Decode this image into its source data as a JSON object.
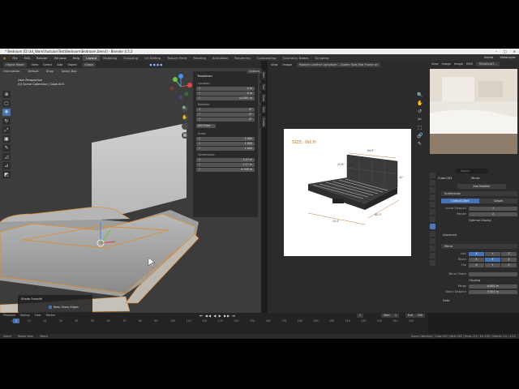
{
  "window": {
    "title": "* Bedroom [D:\\3d_Work\\Youtube\\Test\\Bedroom\\Bedroom.blend] - Blender 4.5.2",
    "controls": [
      "–",
      "□",
      "✕"
    ]
  },
  "menubar": {
    "menus": [
      "File",
      "Edit",
      "Render",
      "Window",
      "Help"
    ],
    "workspaces": [
      "Layout",
      "Modeling",
      "Sculpting",
      "UV Editing",
      "Texture Paint",
      "Shading",
      "Animation",
      "Rendering",
      "Compositing",
      "Geometry Nodes",
      "Scripting"
    ],
    "active_workspace": "Layout",
    "scene": "Scene",
    "view_layer": "ViewLayer"
  },
  "viewport": {
    "header": {
      "mode": "Object Mode",
      "menus": [
        "View",
        "Select",
        "Add",
        "Object"
      ],
      "transform": "Global",
      "orientation_label": "Orientation:",
      "orientation_value": "Default",
      "drag_label": "Drag:",
      "drag_value": "Select Box",
      "options": "Options"
    },
    "info": [
      "User Perspective",
      "(0) Scene Collection | Cube.003"
    ],
    "tools": [
      "⊕",
      "▢",
      "✥",
      "↻",
      "⤢",
      "▣",
      "✎",
      "◿",
      "⊿",
      "◩"
    ],
    "side_tabs": [
      "Item",
      "Tool",
      "View",
      "Edit",
      "Create"
    ],
    "gizmo_icons": [
      "🔍",
      "✋",
      "🎥",
      "▦"
    ],
    "n_panel": {
      "title": "Transform",
      "location_label": "Location:",
      "location": [
        {
          "axis": "X",
          "value": "0 m"
        },
        {
          "axis": "Y",
          "value": "0 m"
        },
        {
          "axis": "Z",
          "value": "0.0381 m"
        }
      ],
      "rotation_label": "Rotation:",
      "rotation": [
        {
          "axis": "X",
          "value": "0°"
        },
        {
          "axis": "Y",
          "value": "0°"
        },
        {
          "axis": "Z",
          "value": "0°"
        }
      ],
      "rotation_mode": "XYZ Euler",
      "scale_label": "Scale:",
      "scale": [
        {
          "axis": "X",
          "value": "1.000"
        },
        {
          "axis": "Y",
          "value": "1.000"
        },
        {
          "axis": "Z",
          "value": "1.000"
        }
      ],
      "dimensions_label": "Dimensions:",
      "dimensions": [
        {
          "axis": "X",
          "value": "1.43 m"
        },
        {
          "axis": "Y",
          "value": "2.17 m"
        },
        {
          "axis": "Z",
          "value": "0.198 m"
        }
      ]
    },
    "operator_panel": {
      "title": "Shade Smooth",
      "option": "Keep Sharp Edges"
    }
  },
  "image_editor": {
    "header": {
      "menus": [
        "View",
        "Image"
      ],
      "image_name": "Modern Leather Upholster... Queen Size,Bed Frame wi"
    },
    "reference": {
      "size_label": "SIZE: INCH",
      "dims": [
        "64.0\"",
        "23.6\"",
        "8.7\"",
        "42\"",
        "85.2\"",
        "15.4\""
      ]
    },
    "side_icons": [
      "🔍",
      "✋",
      "↺",
      "✂",
      "⬚",
      "🔗",
      "✎"
    ]
  },
  "right_preview": {
    "header": [
      "View",
      "Image",
      "Image",
      "RGB"
    ],
    "image_name": "7f0eb9dd7..."
  },
  "properties": {
    "search_placeholder": "Search",
    "object_name": "Cube.003",
    "modifier_context": "Mirror",
    "add_modifier": "Add Modifier",
    "subdivision": {
      "name": "Subdivision",
      "tabs": [
        "Catmull-Clark",
        "Simple"
      ],
      "active_tab": "Catmull-Clark",
      "levels_viewport_label": "Levels Viewport",
      "levels_viewport": "1",
      "render_label": "Render",
      "render": "2",
      "optimal_display": "Optimal Display",
      "advanced": "Advanced"
    },
    "mirror": {
      "name": "Mirror",
      "axis_label": "Axis",
      "bisect_label": "Bisect",
      "flip_label": "Flip",
      "axes": [
        "X",
        "Y",
        "Z"
      ],
      "mirror_object_label": "Mirror Object",
      "clipping": "Clipping",
      "merge_label": "Merge",
      "merge_value": "0.001 m",
      "bisect_distance_label": "Bisect Distance",
      "bisect_distance": "0.001 m",
      "data": "Data"
    }
  },
  "timeline": {
    "header": [
      "Playback",
      "Keying",
      "View",
      "Marker"
    ],
    "current_frame": "1",
    "start_label": "Start",
    "start": "1",
    "end_label": "End",
    "end": "250",
    "ticks": [
      "0",
      "10",
      "20",
      "30",
      "40",
      "50",
      "60",
      "70",
      "80",
      "90",
      "100",
      "110",
      "120",
      "130",
      "140",
      "150",
      "160",
      "170",
      "180",
      "190",
      "200",
      "210",
      "220",
      "230",
      "240",
      "250"
    ],
    "controls": "⏮ ◀◀ ◀ ▶ ▶▶ ⏭"
  },
  "statusbar": {
    "left": [
      "Select",
      "Rotate View",
      "Object"
    ],
    "right": "Scene Collection | Cube.003 | Verts 282 | Faces 2/4 | Tris 108 | Objects 1/4 | 4.5.2"
  },
  "colors": {
    "accent": "#4772b3",
    "selection_outline": "#e08a2b",
    "panel": "#2b2b2b",
    "viewport_bg": "#3c3c3c"
  }
}
